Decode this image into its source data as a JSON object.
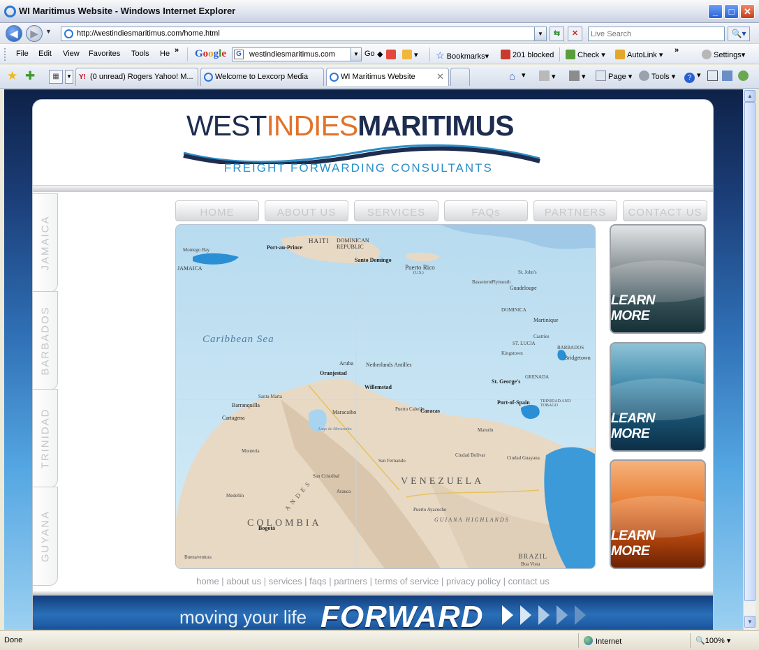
{
  "window": {
    "title": "WI Maritimus Website - Windows Internet Explorer",
    "min": "_",
    "max": "□",
    "close": "✕"
  },
  "address": {
    "url": "http://westindiesmaritimus.com/home.html",
    "search_placeholder": "Live Search"
  },
  "menu": {
    "items": [
      "File",
      "Edit",
      "View",
      "Favorites",
      "Tools",
      "He"
    ],
    "overflow": "»"
  },
  "google_toolbar": {
    "logo": [
      "G",
      "o",
      "o",
      "g",
      "l",
      "e"
    ],
    "search_value": "westindiesmaritimus.com",
    "go": "Go",
    "bookmarks": "Bookmarks",
    "blocked": "201 blocked",
    "check": "Check",
    "autolink": "AutoLink",
    "overflow": "»",
    "settings": "Settings"
  },
  "tabs": {
    "items": [
      {
        "label": "(0 unread) Rogers Yahoo! M...",
        "icon": "yahoo-icon"
      },
      {
        "label": "Welcome to Lexcorp Media",
        "icon": "ie-page-icon"
      },
      {
        "label": "WI Maritimus Website",
        "icon": "ie-page-icon"
      }
    ],
    "close": "✕"
  },
  "commandbar": {
    "page": "Page",
    "tools": "Tools"
  },
  "site": {
    "logo_west": "WEST",
    "logo_indies": "INDIES",
    "logo_maritimus": "MARITIMUS",
    "tagline": "FREIGHT FORWARDING CONSULTANTS",
    "nav": [
      "HOME",
      "ABOUT US",
      "SERVICES",
      "FAQs",
      "PARTNERS",
      "CONTACT US"
    ],
    "side_tabs": [
      "JAMAICA",
      "BARBADOS",
      "TRINIDAD",
      "GUYANA"
    ],
    "learn_more": [
      "LEARN MORE",
      "LEARN MORE",
      "LEARN MORE"
    ],
    "footer_links": [
      "home",
      "about us",
      "services",
      "faqs",
      "partners",
      "terms of service",
      "privacy policy",
      "contact us"
    ],
    "banner_text": "moving your life",
    "banner_forward": "FORWARD",
    "colors": {
      "navy": "#1e2d4f",
      "orange": "#e2722a",
      "teal": "#2a8ec8"
    }
  },
  "map": {
    "labels": {
      "caribbean_sea": "Caribbean Sea",
      "jamaica": "JAMAICA",
      "haiti": "HAITI",
      "dominican": "DOMINICAN REPUBLIC",
      "santo_domingo": "Santo Domingo",
      "puerto_rico": "Puerto Rico",
      "port_au_prince": "Port-au-Prince",
      "montego_bay": "Montego Bay",
      "aruba": "Aruba",
      "oranjestad": "Oranjestad",
      "netherlands_antilles": "Netherlands Antilles",
      "willemstad": "Willemstad",
      "venezuela": "VENEZUELA",
      "colombia": "COLOMBIA",
      "caracas": "Caracas",
      "barranquilla": "Barranquilla",
      "cartagena": "Cartagena",
      "maracaibo": "Maracaibo",
      "bogota": "Bogotá",
      "medellin": "Medellín",
      "port_of_spain": "Port-of-Spain",
      "trinidad_tobago": "TRINIDAD AND TOBAGO",
      "barbados": "BARBADOS",
      "bridgetown": "Bridgetown",
      "st_lucia": "ST. LUCIA",
      "castries": "Castries",
      "martinique": "Martinique",
      "guadeloupe": "Guadeloupe",
      "dominica": "DOMINICA",
      "kingstown": "Kingstown",
      "st_georges": "St. George's",
      "san_fernando": "San Fernando",
      "ciudad_guayana": "Ciudad Guayana",
      "brazil": "BRAZIL",
      "guiana_highlands": "GUIANA HIGHLANDS",
      "plymouth": "Plymouth",
      "basseterre": "Basseterre",
      "st_johns": "St. John's",
      "maturin": "Maturín",
      "puerto_cabello": "Puerto Cabello",
      "buenaventura": "Buenaventura",
      "arauca": "Arauca",
      "san_cristobal": "San Cristóbal",
      "santa_marta": "Santa Marta",
      "monteria": "Montería",
      "ciudad_bolivar": "Ciudad Bolívar",
      "puerto_ayacucho": "Puerto Ayacucho",
      "andes": "ANDES",
      "grenada": "GRENADA",
      "boa_vista": "Boa Vista",
      "lago_maracaibo": "Lago de Maracaibo",
      "puerto_rico_us": "(U.S.)"
    }
  },
  "status": {
    "left": "Done",
    "zone": "Internet",
    "zoom": "100%"
  }
}
